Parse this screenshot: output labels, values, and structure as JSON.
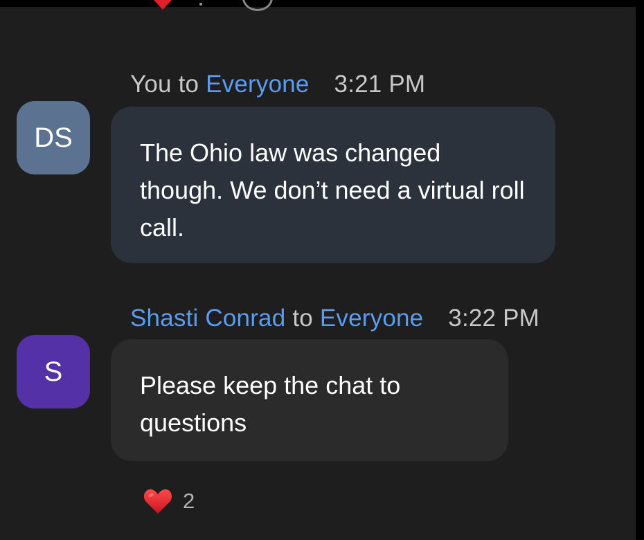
{
  "colors": {
    "background": "#1e1e1e",
    "accent_blue": "#5b9bf2",
    "meta_gray": "#c8c8c8",
    "bubble_self": "#2b323c",
    "bubble_other": "#2b2b2b",
    "avatar_ds": "#5b7290",
    "avatar_s": "#5531a8",
    "heart_red": "#e0202a"
  },
  "messages": [
    {
      "sender": "You",
      "connector": "to",
      "recipient": "Everyone",
      "time": "3:21 PM",
      "avatar_initials": "DS",
      "text": "The Ohio law was changed though. We don’t need a virtual roll call."
    },
    {
      "sender": "Shasti Conrad",
      "connector": "to",
      "recipient": "Everyone",
      "time": "3:22 PM",
      "avatar_initials": "S",
      "text": "Please keep the chat to questions"
    }
  ],
  "reaction": {
    "icon": "heart-icon",
    "count": "2"
  }
}
